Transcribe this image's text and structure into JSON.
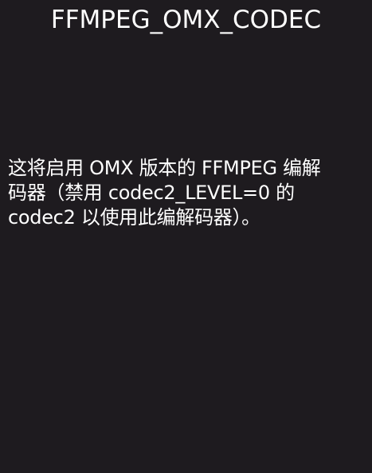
{
  "dialog": {
    "title": "FFMPEG_OMX_CODEC",
    "description_lines": [
      "这将启用 OMX 版本的 FFMPEG 编解",
      "码器（禁用 codec2_LEVEL=0 的",
      "codec2 以使用此编解码器）。"
    ]
  },
  "colors": {
    "background": "#1e1b1f",
    "text": "#ffffff"
  }
}
